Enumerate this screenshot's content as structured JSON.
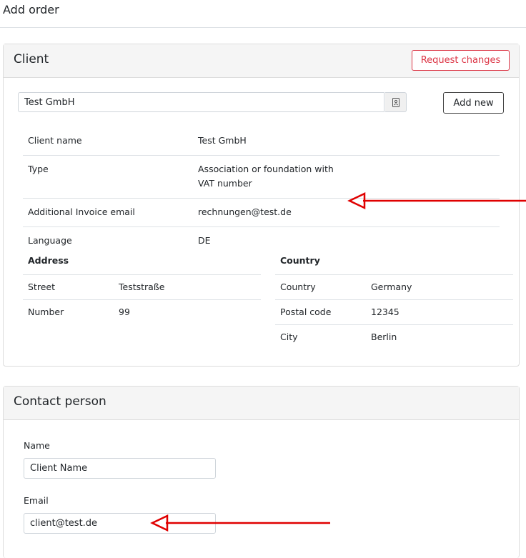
{
  "page": {
    "title": "Add order"
  },
  "client_card": {
    "title": "Client",
    "request_changes_label": "Request changes",
    "search_value": "Test GmbH",
    "add_new_label": "Add new",
    "info_rows": [
      {
        "label": "Client name",
        "value": "Test GmbH"
      },
      {
        "label": "Type",
        "value": "Association or foundation with VAT number"
      },
      {
        "label": "Additional Invoice email",
        "value": "rechnungen@test.de"
      },
      {
        "label": "Language",
        "value": "DE"
      }
    ],
    "address": {
      "header": "Address",
      "rows": [
        {
          "label": "Street",
          "value": "Teststraße"
        },
        {
          "label": "Number",
          "value": "99"
        }
      ]
    },
    "country": {
      "header": "Country",
      "rows": [
        {
          "label": "Country",
          "value": "Germany"
        },
        {
          "label": "Postal code",
          "value": "12345"
        },
        {
          "label": "City",
          "value": "Berlin"
        }
      ]
    }
  },
  "contact_card": {
    "title": "Contact person",
    "name_label": "Name",
    "name_value": "Client Name",
    "email_label": "Email",
    "email_value": "client@test.de"
  },
  "colors": {
    "danger": "#dc3545",
    "annotation_arrow": "#e00000",
    "card_header_bg": "#f5f5f5"
  }
}
